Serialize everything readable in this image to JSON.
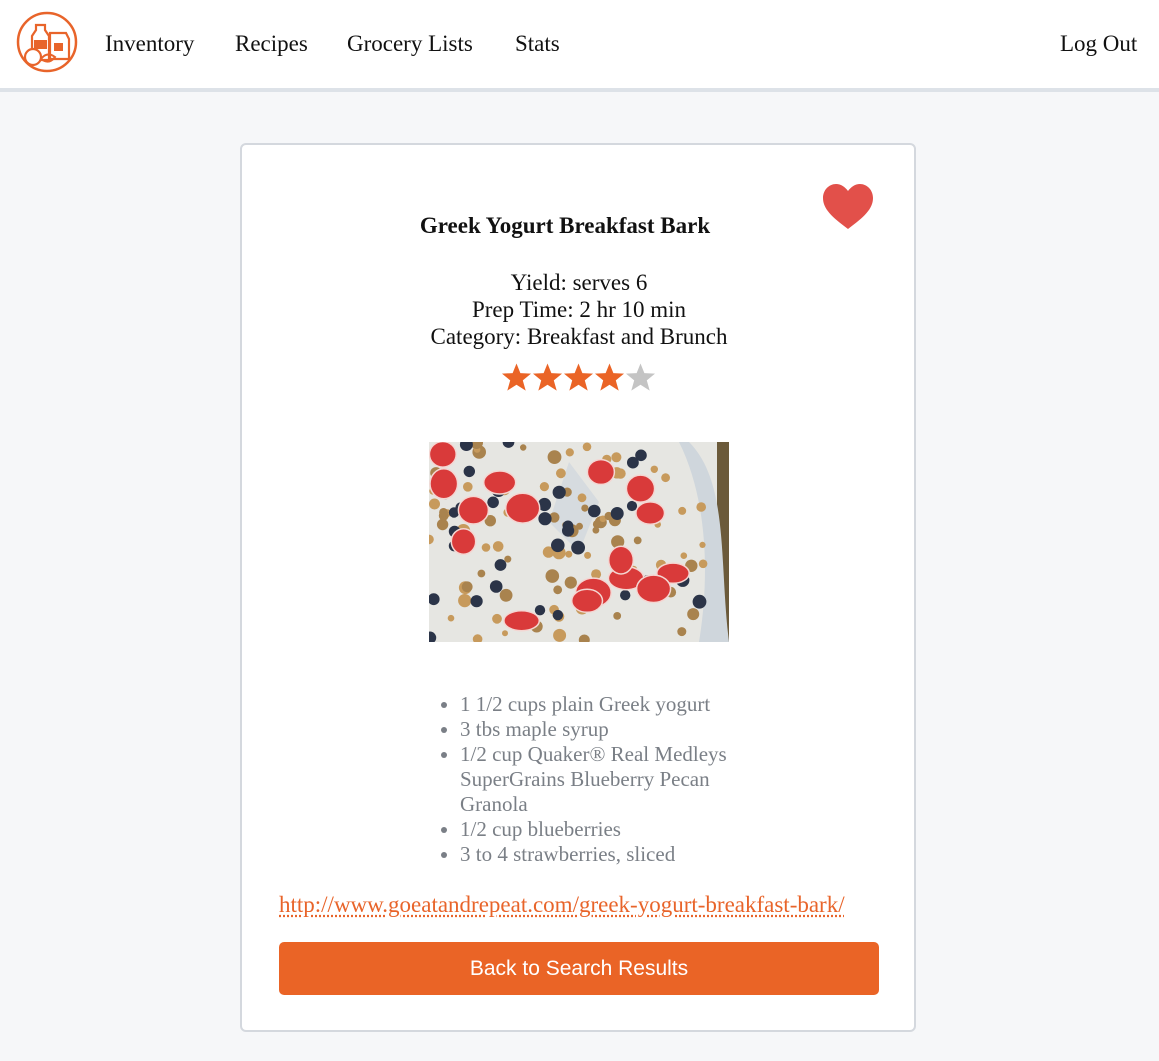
{
  "nav": {
    "logo_icon": "pantry-grocery-logo-icon",
    "items": [
      {
        "label": "Inventory"
      },
      {
        "label": "Recipes"
      },
      {
        "label": "Grocery Lists"
      },
      {
        "label": "Stats"
      }
    ],
    "logout_label": "Log Out"
  },
  "recipe": {
    "favorite_icon": "heart-icon",
    "favorite_color": "#e2504a",
    "title": "Greek Yogurt Breakfast Bark",
    "yield": "Yield: serves 6",
    "prep_time": "Prep Time: 2 hr 10 min",
    "category": "Category: Breakfast and Brunch",
    "rating": 4,
    "rating_max": 5,
    "star_filled_color": "#ea6426",
    "star_empty_color": "#c4c4c4",
    "ingredients": [
      "1 1/2 cups plain Greek yogurt",
      "3 tbs maple syrup",
      "1/2 cup Quaker® Real Medleys SuperGrains Blueberry Pecan Granola",
      "1/2 cup blueberries",
      "3 to 4 strawberries, sliced"
    ],
    "source_url": "http://www.goeatandrepeat.com/greek-yogurt-breakfast-bark/",
    "back_button_label": "Back to Search Results"
  },
  "colors": {
    "accent": "#ea6426",
    "page_background": "#f6f7f9",
    "ingredient_text": "#7a7f86"
  }
}
